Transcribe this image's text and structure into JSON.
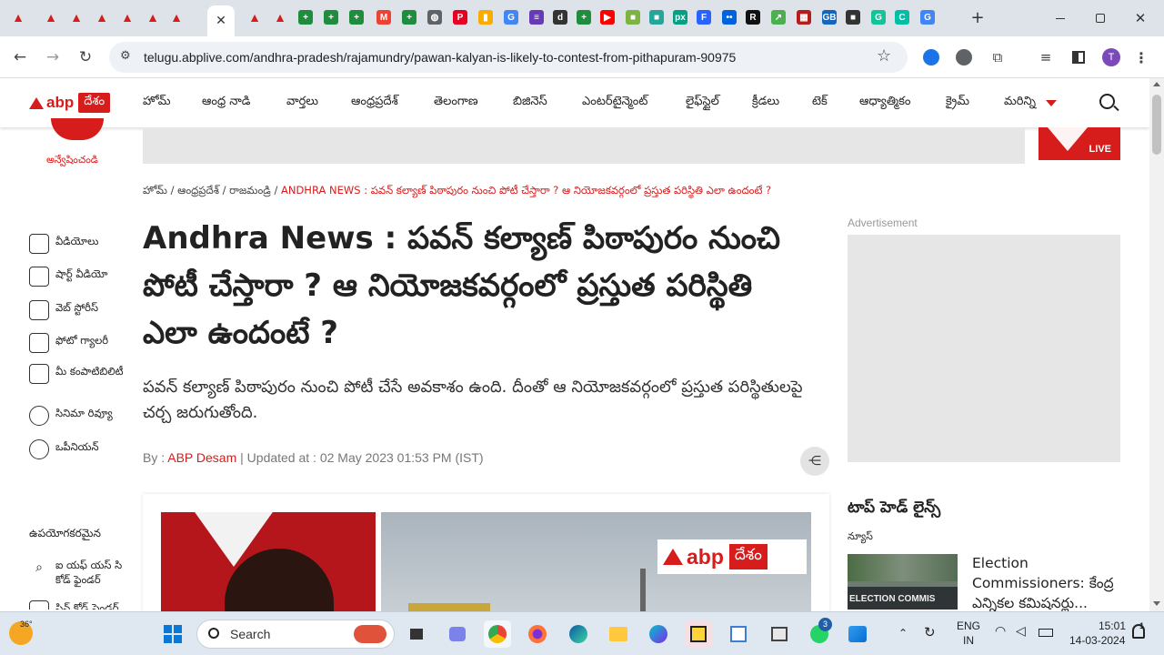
{
  "browser": {
    "close_tab_glyph": "✕",
    "new_tab_glyph": "+",
    "url": "telugu.abplive.com/andhra-pradesh/rajamundry/pawan-kalyan-is-likely-to-contest-from-pithapuram-90975",
    "profile_initial": "T",
    "tabs": [
      {
        "icon": "abp-tab-icon",
        "color": "#d71c1c"
      },
      {
        "icon": "abp-tab-icon",
        "color": "#d71c1c"
      },
      {
        "icon": "abp-tab-icon",
        "color": "#d71c1c"
      },
      {
        "icon": "abp-tab-icon",
        "color": "#d71c1c"
      },
      {
        "icon": "abp-tab-icon",
        "color": "#d71c1c"
      },
      {
        "icon": "abp-tab-icon",
        "color": "#d71c1c"
      },
      {
        "icon": "abp-tab-icon",
        "color": "#d71c1c"
      },
      {
        "icon": "active-tab",
        "color": "#ffffff"
      },
      {
        "icon": "abp-tab-icon",
        "color": "#d71c1c"
      },
      {
        "icon": "abp-tab-icon",
        "color": "#d71c1c"
      },
      {
        "icon": "sheets-tab-icon",
        "color": "#1e8e3e"
      },
      {
        "icon": "sheets-tab-icon",
        "color": "#1e8e3e"
      },
      {
        "icon": "sheets-tab-icon",
        "color": "#1e8e3e"
      },
      {
        "icon": "gmail-tab-icon",
        "color": "#ea4335"
      },
      {
        "icon": "sheets-tab-icon",
        "color": "#1e8e3e"
      },
      {
        "icon": "globe-tab-icon",
        "color": "#5f6368"
      },
      {
        "icon": "pinterest-tab-icon",
        "color": "#e60023"
      },
      {
        "icon": "analytics-tab-icon",
        "color": "#f9ab00"
      },
      {
        "icon": "translate-tab-icon",
        "color": "#4285f4"
      },
      {
        "icon": "forms-tab-icon",
        "color": "#673ab7"
      },
      {
        "icon": "d-tab-icon",
        "color": "#333333"
      },
      {
        "icon": "sheets-tab-icon",
        "color": "#1e8e3e"
      },
      {
        "icon": "youtube-tab-icon",
        "color": "#ff0000"
      },
      {
        "icon": "app-tab-icon",
        "color": "#7cb342"
      },
      {
        "icon": "app-tab-icon",
        "color": "#26a69a"
      },
      {
        "icon": "px-tab-icon",
        "color": "#05a081"
      },
      {
        "icon": "f-tab-icon",
        "color": "#2962ff"
      },
      {
        "icon": "flickr-tab-icon",
        "color": "#0063dc"
      },
      {
        "icon": "r-tab-icon",
        "color": "#111111"
      },
      {
        "icon": "trend-tab-icon",
        "color": "#4caf50"
      },
      {
        "icon": "grid-tab-icon",
        "color": "#b71c1c"
      },
      {
        "icon": "gb-tab-icon",
        "color": "#1565c0"
      },
      {
        "icon": "app-tab-icon",
        "color": "#333333"
      },
      {
        "icon": "grammarly-tab-icon",
        "color": "#15c39a"
      },
      {
        "icon": "c-tab-icon",
        "color": "#00bfa5"
      },
      {
        "icon": "google-tab-icon",
        "color": "#4285f4"
      }
    ],
    "tab_letters": {
      "abp-tab-icon": "▲",
      "sheets-tab-icon": "+",
      "gmail-tab-icon": "M",
      "globe-tab-icon": "◍",
      "pinterest-tab-icon": "P",
      "analytics-tab-icon": "▮",
      "translate-tab-icon": "G",
      "forms-tab-icon": "≡",
      "d-tab-icon": "d",
      "youtube-tab-icon": "▶",
      "app-tab-icon": "■",
      "px-tab-icon": "px",
      "f-tab-icon": "F",
      "flickr-tab-icon": "••",
      "r-tab-icon": "R",
      "trend-tab-icon": "↗",
      "grid-tab-icon": "▦",
      "gb-tab-icon": "GB",
      "grammarly-tab-icon": "G",
      "c-tab-icon": "C",
      "google-tab-icon": "G"
    }
  },
  "site": {
    "logo_text": "abp",
    "logo_badge": "దేశం",
    "menu": [
      "హోమ్",
      "ఆంధ్ర నాడి",
      "వార్తలు",
      "ఆంధ్రప్రదేశ్",
      "తెలంగాణ",
      "బిజినెస్",
      "ఎంటర్‌టైన్మెంట్",
      "లైఫ్‌స్టైల్",
      "క్రీడలు",
      "టెక్",
      "ఆధ్యాత్మికం",
      "క్రైమ్",
      "మరిన్ని"
    ],
    "search_label": "అన్వేషించండి",
    "live_label": "LIVE"
  },
  "sidebar": {
    "items": [
      {
        "label": "వీడియోలు",
        "icon": "video-icon"
      },
      {
        "label": "షార్ట్ వీడియో",
        "icon": "short-video-icon"
      },
      {
        "label": "వెబ్ స్టోరీస్",
        "icon": "web-stories-icon"
      },
      {
        "label": "ఫోటో గ్యాలరీ",
        "icon": "photo-gallery-icon"
      },
      {
        "label": "మీ కంపాటిబిలిటీ",
        "icon": "compatibility-icon"
      },
      {
        "label": "సినిమా రివ్యూ",
        "icon": "film-review-icon"
      },
      {
        "label": "ఒపీనియన్",
        "icon": "opinion-icon"
      }
    ],
    "useful_heading": "ఉపయోగకరమైన",
    "useful_items": [
      {
        "label": "ఐ యఫ్ యస్ సి కోడ్ ఫైండర్",
        "icon": "ifsc-finder-icon"
      }
    ],
    "partial_label": "పిన్ కోడ్ ఫైండర్"
  },
  "article": {
    "breadcrumb": {
      "home": "హోమ్",
      "sep": "/",
      "section": "ఆంధ్రప్రదేశ్",
      "city": "రాజమండ్రి",
      "current": "ANDHRA NEWS : పవన్ కల్యాణ్ పిఠాపురం నుంచి పోటీ చేస్తారా ? ఆ నియోజకవర్గంలో ప్రస్తుత పరిస్థితి ఎలా ఉందంటే ?"
    },
    "headline": "Andhra News : పవన్ కల్యాణ్ పిఠాపురం నుంచి పోటీ చేస్తారా ? ఆ నియోజకవర్గంలో ప్రస్తుత పరిస్థితి ఎలా ఉందంటే ?",
    "subtitle": "పవన్ కల్యాణ్ పిఠాపురం నుంచి పోటీ చేసే అవకాశం ఉంది. దీంతో ఆ నియోజకవర్గంలో ప్రస్తుత పరిస్థితులపై చర్చ జరుగుతోంది.",
    "by_prefix": "By :",
    "author": "ABP Desam",
    "updated": "| Updated at : 02 May 2023 01:53 PM (IST)",
    "image_logo_text": "abp",
    "image_logo_badge": "దేశం"
  },
  "right_rail": {
    "ad_label": "Advertisement",
    "top_headlines": "టాప్ హెడ్ లైన్స్",
    "news_label": "న్యూస్",
    "news_title": "Election Commissioners: కేంద్ర ఎన్నికల కమిషనర్లు...",
    "thumb_text": "ELECTION COMMIS"
  },
  "taskbar": {
    "weather": "36°",
    "search_placeholder": "Search",
    "lang_line1": "ENG",
    "lang_line2": "IN",
    "time": "15:01",
    "date": "14-03-2024",
    "whatsapp_badge": "3",
    "notif_badge": "1"
  }
}
